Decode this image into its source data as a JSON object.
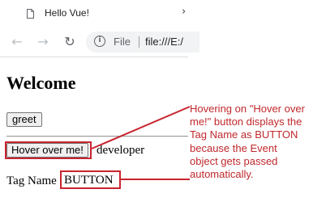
{
  "browser": {
    "tab_title": "Hello Vue!",
    "tab_close_glyph": "›",
    "back_glyph": "←",
    "forward_glyph": "→",
    "reload_glyph": "↻",
    "info_glyph": "i",
    "scheme_label": "File",
    "url": "file:///E:/"
  },
  "page": {
    "heading": "Welcome",
    "greet_button": "greet",
    "hover_button": "Hover over me!",
    "developer_text": "developer",
    "tag_name_label": "Tag Name",
    "tag_name_value": "BUTTON"
  },
  "annotation": {
    "lines": [
      "Hovering on \"Hover over",
      "me!\" button displays the",
      "Tag Name as BUTTON",
      "because the Event",
      "object gets passed",
      "automatically."
    ]
  },
  "colors": {
    "highlight": "#c8242e",
    "annotation_text": "#c0282c"
  },
  "icons": {
    "tab": "document-icon",
    "back": "arrow-left-icon",
    "forward": "arrow-right-icon",
    "reload": "reload-icon",
    "info": "info-icon"
  }
}
